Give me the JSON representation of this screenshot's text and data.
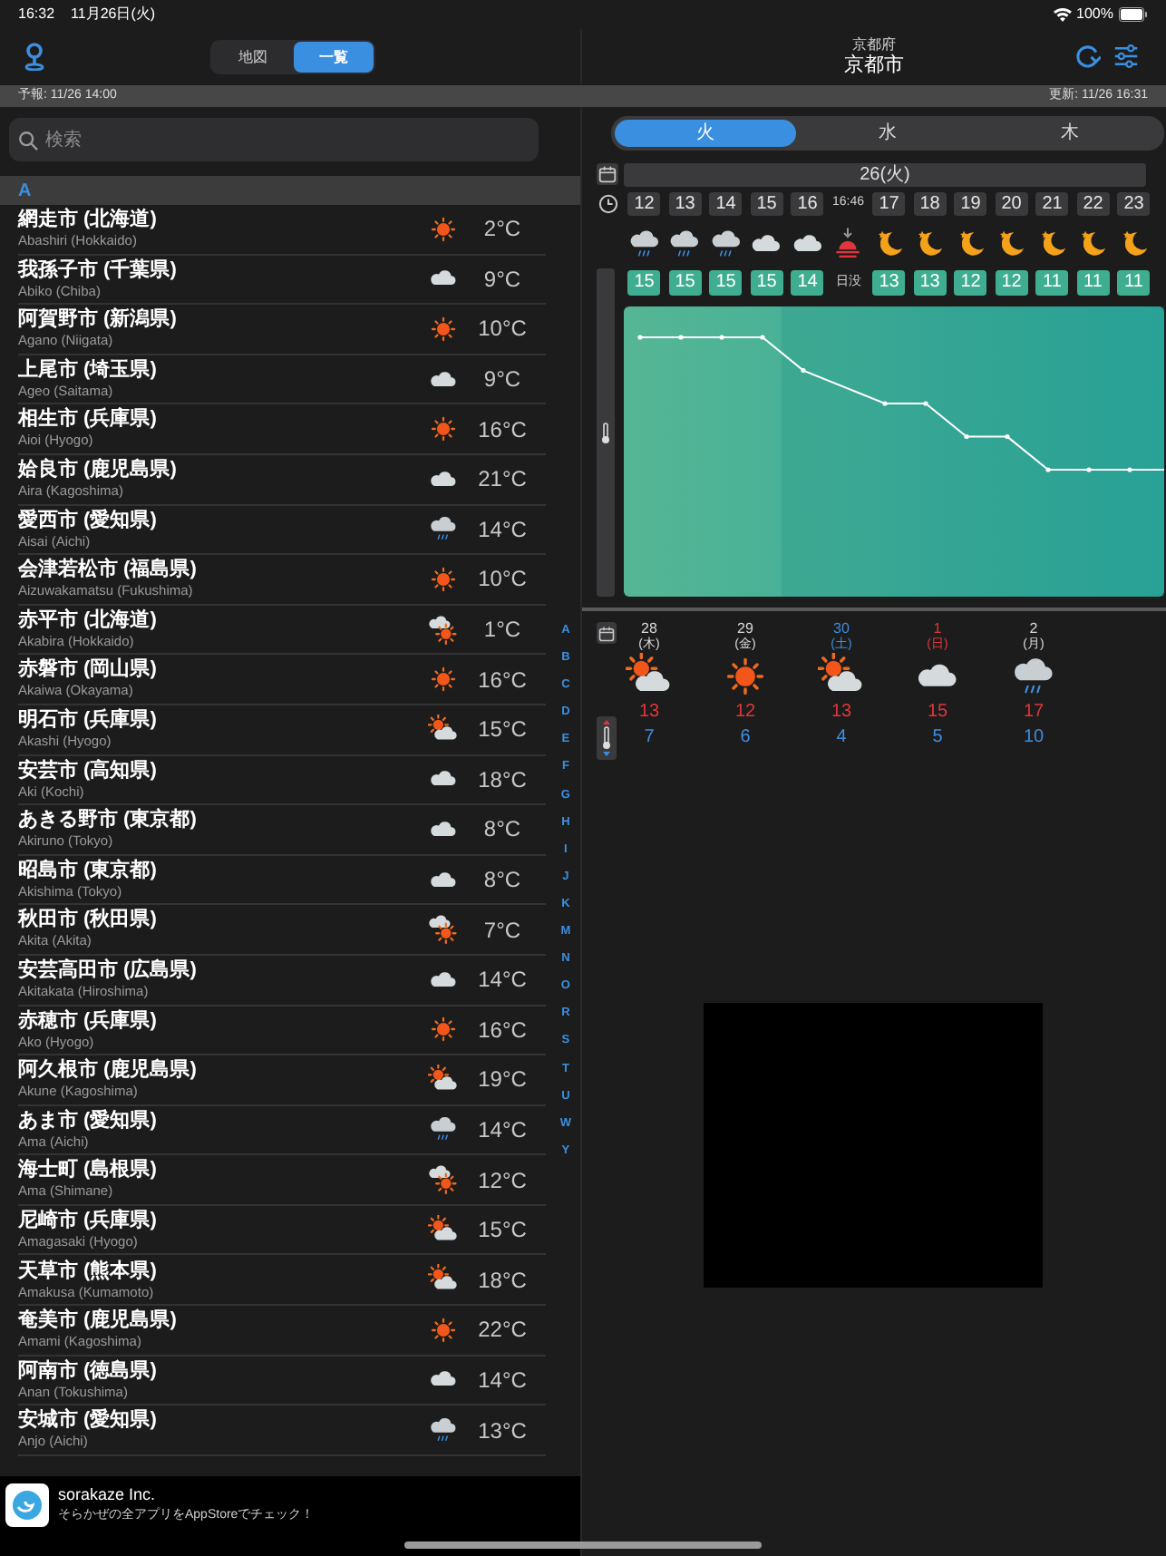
{
  "status_bar": {
    "time": "16:32",
    "date": "11月26日(火)",
    "battery": "100%"
  },
  "nav": {
    "segments": [
      {
        "label": "地図",
        "selected": false
      },
      {
        "label": "一覧",
        "selected": true
      }
    ],
    "prefecture": "京都府",
    "city": "京都市"
  },
  "info_bar": {
    "forecast": "予報: 11/26 14:00",
    "updated": "更新: 11/26 16:31"
  },
  "search": {
    "placeholder": "検索"
  },
  "section": "A",
  "cities": [
    {
      "name": "網走市 (北海道)",
      "romaji": "Abashiri (Hokkaido)",
      "weather": {
        "kind": "sun"
      },
      "temp": "2°C"
    },
    {
      "name": "我孫子市 (千葉県)",
      "romaji": "Abiko (Chiba)",
      "weather": {
        "kind": "cloud"
      },
      "temp": "9°C"
    },
    {
      "name": "阿賀野市 (新潟県)",
      "romaji": "Agano (Niigata)",
      "weather": {
        "kind": "sun"
      },
      "temp": "10°C"
    },
    {
      "name": "上尾市 (埼玉県)",
      "romaji": "Ageo (Saitama)",
      "weather": {
        "kind": "cloud"
      },
      "temp": "9°C"
    },
    {
      "name": "相生市 (兵庫県)",
      "romaji": "Aioi (Hyogo)",
      "weather": {
        "kind": "sun"
      },
      "temp": "16°C"
    },
    {
      "name": "姶良市 (鹿児島県)",
      "romaji": "Aira (Kagoshima)",
      "weather": {
        "kind": "cloud"
      },
      "temp": "21°C"
    },
    {
      "name": "愛西市 (愛知県)",
      "romaji": "Aisai (Aichi)",
      "weather": {
        "kind": "rain"
      },
      "temp": "14°C"
    },
    {
      "name": "会津若松市 (福島県)",
      "romaji": "Aizuwakamatsu (Fukushima)",
      "weather": {
        "kind": "sun"
      },
      "temp": "10°C"
    },
    {
      "name": "赤平市 (北海道)",
      "romaji": "Akabira (Hokkaido)",
      "weather": {
        "kind": "cloud_sun"
      },
      "temp": "1°C"
    },
    {
      "name": "赤磐市 (岡山県)",
      "romaji": "Akaiwa (Okayama)",
      "weather": {
        "kind": "sun"
      },
      "temp": "16°C"
    },
    {
      "name": "明石市 (兵庫県)",
      "romaji": "Akashi (Hyogo)",
      "weather": {
        "kind": "sun_cloud"
      },
      "temp": "15°C"
    },
    {
      "name": "安芸市 (高知県)",
      "romaji": "Aki (Kochi)",
      "weather": {
        "kind": "cloud"
      },
      "temp": "18°C"
    },
    {
      "name": "あきる野市 (東京都)",
      "romaji": "Akiruno (Tokyo)",
      "weather": {
        "kind": "cloud"
      },
      "temp": "8°C"
    },
    {
      "name": "昭島市 (東京都)",
      "romaji": "Akishima (Tokyo)",
      "weather": {
        "kind": "cloud"
      },
      "temp": "8°C"
    },
    {
      "name": "秋田市 (秋田県)",
      "romaji": "Akita (Akita)",
      "weather": {
        "kind": "cloud_sun"
      },
      "temp": "7°C"
    },
    {
      "name": "安芸高田市 (広島県)",
      "romaji": "Akitakata (Hiroshima)",
      "weather": {
        "kind": "cloud"
      },
      "temp": "14°C"
    },
    {
      "name": "赤穂市 (兵庫県)",
      "romaji": "Ako (Hyogo)",
      "weather": {
        "kind": "sun"
      },
      "temp": "16°C"
    },
    {
      "name": "阿久根市 (鹿児島県)",
      "romaji": "Akune (Kagoshima)",
      "weather": {
        "kind": "sun_cloud"
      },
      "temp": "19°C"
    },
    {
      "name": "あま市 (愛知県)",
      "romaji": "Ama (Aichi)",
      "weather": {
        "kind": "rain"
      },
      "temp": "14°C"
    },
    {
      "name": "海士町 (島根県)",
      "romaji": "Ama (Shimane)",
      "weather": {
        "kind": "cloud_sun"
      },
      "temp": "12°C"
    },
    {
      "name": "尼崎市 (兵庫県)",
      "romaji": "Amagasaki (Hyogo)",
      "weather": {
        "kind": "sun_cloud"
      },
      "temp": "15°C"
    },
    {
      "name": "天草市 (熊本県)",
      "romaji": "Amakusa (Kumamoto)",
      "weather": {
        "kind": "sun_cloud"
      },
      "temp": "18°C"
    },
    {
      "name": "奄美市 (鹿児島県)",
      "romaji": "Amami (Kagoshima)",
      "weather": {
        "kind": "sun"
      },
      "temp": "22°C"
    },
    {
      "name": "阿南市 (徳島県)",
      "romaji": "Anan (Tokushima)",
      "weather": {
        "kind": "cloud"
      },
      "temp": "14°C"
    },
    {
      "name": "安城市 (愛知県)",
      "romaji": "Anjo (Aichi)",
      "weather": {
        "kind": "rain"
      },
      "temp": "13°C"
    }
  ],
  "index_letters": [
    "A",
    "B",
    "C",
    "D",
    "E",
    "F",
    "G",
    "H",
    "I",
    "J",
    "K",
    "M",
    "N",
    "O",
    "R",
    "S",
    "T",
    "U",
    "W",
    "Y"
  ],
  "day_tabs": [
    {
      "label": "火",
      "selected": true
    },
    {
      "label": "水",
      "selected": false
    },
    {
      "label": "木",
      "selected": false
    }
  ],
  "hourly": {
    "date": "26(火)",
    "hours": [
      {
        "kind": "hour",
        "time": "12",
        "weather": {
          "kind": "rain"
        },
        "temp": "15"
      },
      {
        "kind": "hour",
        "time": "13",
        "weather": {
          "kind": "rain"
        },
        "temp": "15"
      },
      {
        "kind": "hour",
        "time": "14",
        "weather": {
          "kind": "rain"
        },
        "temp": "15"
      },
      {
        "kind": "hour",
        "time": "15",
        "weather": {
          "kind": "cloud"
        },
        "temp": "15"
      },
      {
        "kind": "hour",
        "time": "16",
        "weather": {
          "kind": "cloud"
        },
        "temp": "14"
      },
      {
        "kind": "sunset",
        "time": "16:46",
        "weather": {
          "kind": "sunset"
        },
        "temp": "日没"
      },
      {
        "kind": "hour",
        "time": "17",
        "weather": {
          "kind": "moon"
        },
        "temp": "13"
      },
      {
        "kind": "hour",
        "time": "18",
        "weather": {
          "kind": "moon"
        },
        "temp": "13"
      },
      {
        "kind": "hour",
        "time": "19",
        "weather": {
          "kind": "moon"
        },
        "temp": "12"
      },
      {
        "kind": "hour",
        "time": "20",
        "weather": {
          "kind": "moon"
        },
        "temp": "12"
      },
      {
        "kind": "hour",
        "time": "21",
        "weather": {
          "kind": "moon"
        },
        "temp": "11"
      },
      {
        "kind": "hour",
        "time": "22",
        "weather": {
          "kind": "moon"
        },
        "temp": "11"
      },
      {
        "kind": "hour",
        "time": "23",
        "weather": {
          "kind": "moon"
        },
        "temp": "11"
      }
    ]
  },
  "daily": [
    {
      "day": "28",
      "weekday": "(木)",
      "kind": "weekday",
      "weather": {
        "kind": "sun_cloud"
      },
      "high": "13",
      "low": "7"
    },
    {
      "day": "29",
      "weekday": "(金)",
      "kind": "weekday",
      "weather": {
        "kind": "sun"
      },
      "high": "12",
      "low": "6"
    },
    {
      "day": "30",
      "weekday": "(土)",
      "kind": "saturday",
      "weather": {
        "kind": "sun_cloud"
      },
      "high": "13",
      "low": "4"
    },
    {
      "day": "1",
      "weekday": "(日)",
      "kind": "sunday",
      "weather": {
        "kind": "cloud"
      },
      "high": "15",
      "low": "5"
    },
    {
      "day": "2",
      "weekday": "(月)",
      "kind": "weekday",
      "weather": {
        "kind": "rain"
      },
      "high": "17",
      "low": "10"
    }
  ],
  "ad": {
    "title": "sorakaze Inc.",
    "message": "そらかぜの全アプリをAppStoreでチェック！"
  }
}
